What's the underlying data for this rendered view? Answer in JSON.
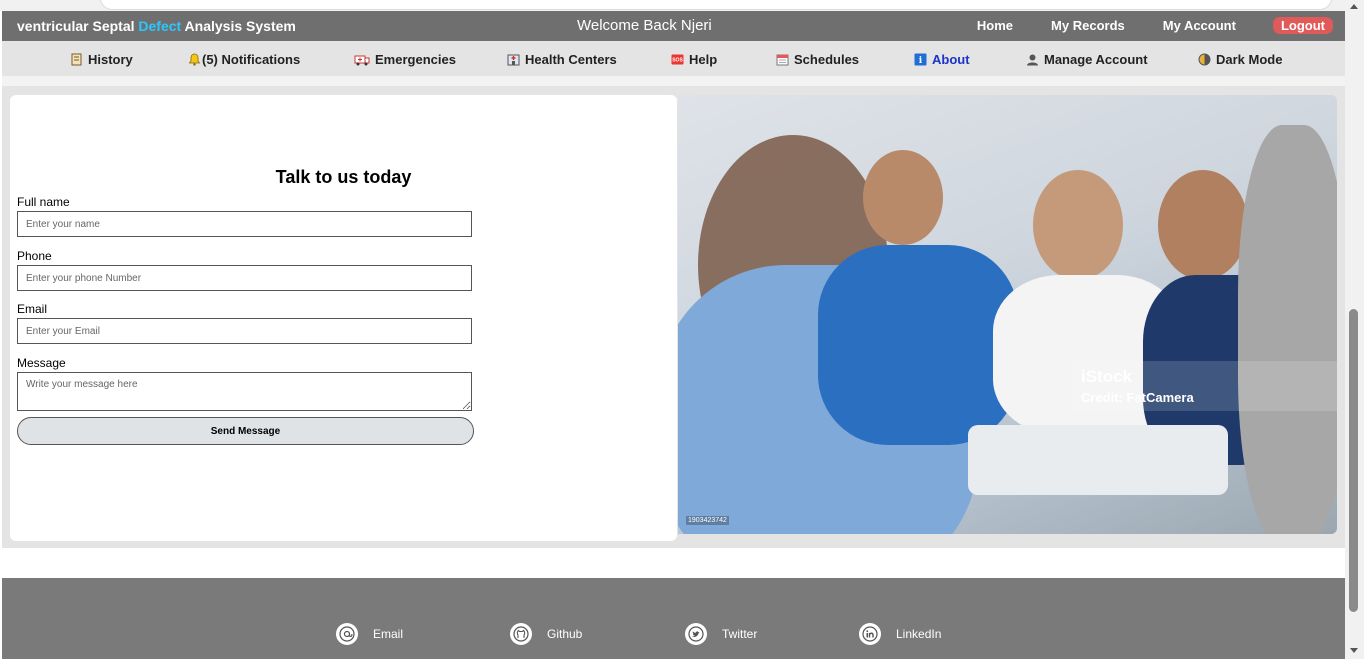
{
  "header": {
    "brand_part1": "ventricular Septal ",
    "brand_accent": "Defect",
    "brand_part2": " Analysis System",
    "welcome": "Welcome Back Njeri",
    "nav": {
      "home": "Home",
      "records": "My Records",
      "account": "My Account",
      "logout": "Logout"
    }
  },
  "subnav": {
    "history": "History",
    "notifications": "(5) Notifications",
    "emergencies": "Emergencies",
    "health_centers": "Health Centers",
    "help": "Help",
    "schedules": "Schedules",
    "about": "About",
    "manage_account": "Manage Account",
    "dark_mode": "Dark Mode"
  },
  "form": {
    "title": "Talk to us today",
    "fullname_label": "Full name",
    "fullname_placeholder": "Enter your name",
    "phone_label": "Phone",
    "phone_placeholder": "Enter your phone Number",
    "email_label": "Email",
    "email_placeholder": "Enter your Email",
    "message_label": "Message",
    "message_placeholder": "Write your message here",
    "send_label": "Send Message"
  },
  "photo": {
    "watermark_brand": "iStock",
    "watermark_credit": "Credit: FatCamera",
    "image_id": "1903423742"
  },
  "footer": {
    "email": "Email",
    "github": "Github",
    "twitter": "Twitter",
    "linkedin": "LinkedIn"
  },
  "colors": {
    "header_bg": "#6f6f6f",
    "accent": "#2bc7ff",
    "logout_bg": "#e05a5a",
    "subnav_bg": "#e4e4e4",
    "active_link": "#1a33c8",
    "footer_bg": "#7a7a7a"
  }
}
